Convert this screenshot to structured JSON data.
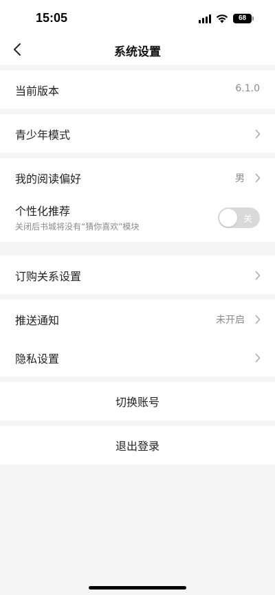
{
  "status_bar": {
    "time": "15:05",
    "battery": "68"
  },
  "nav": {
    "title": "系统设置"
  },
  "version_section": {
    "label": "当前版本",
    "value": "6.1.0"
  },
  "youth_section": {
    "label": "青少年模式"
  },
  "preference_section": {
    "reading_pref_label": "我的阅读偏好",
    "reading_pref_value": "男",
    "personalized_label": "个性化推荐",
    "personalized_sub": "关闭后书城将没有“猜你喜欢”模块",
    "toggle_text": "关",
    "toggle_on": false
  },
  "subscription_section": {
    "label": "订购关系设置"
  },
  "notify_section": {
    "push_label": "推送通知",
    "push_value": "未开启",
    "privacy_label": "隐私设置"
  },
  "actions": {
    "switch_account": "切换账号",
    "logout": "退出登录"
  },
  "colors": {
    "background": "#f5f5f5",
    "card": "#ffffff",
    "secondary_text": "#8a8a8a",
    "toggle_off": "#d9d9d9"
  }
}
